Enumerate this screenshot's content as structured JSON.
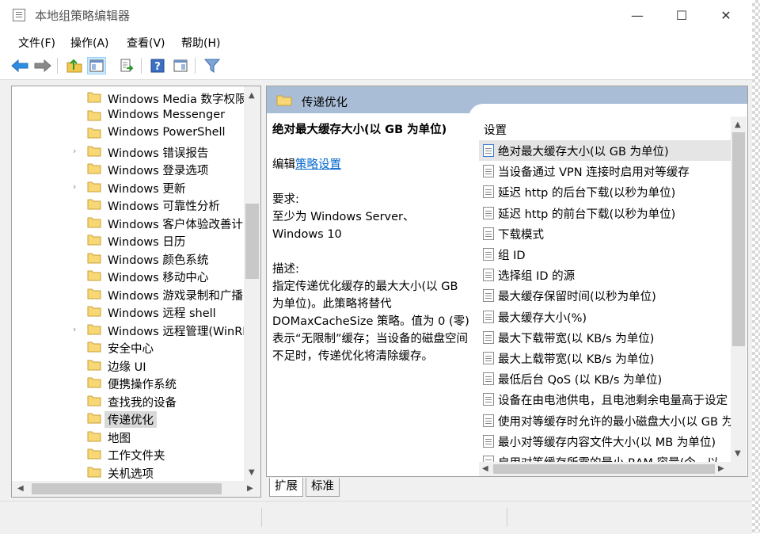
{
  "window": {
    "title": "本地组策略编辑器",
    "minimize": "—",
    "maximize": "☐",
    "close": "✕"
  },
  "menu": [
    "文件(F)",
    "操作(A)",
    "查看(V)",
    "帮助(H)"
  ],
  "toolbar": {
    "icons": [
      "back-arrow-icon",
      "forward-arrow-icon",
      "up-folder-icon",
      "show-hide-tree-icon",
      "export-list-icon",
      "help-icon",
      "properties-pane-icon",
      "filter-icon"
    ],
    "help_glyph": "?"
  },
  "tree": {
    "items": [
      {
        "label": "Windows Media 数字权限",
        "expandable": false
      },
      {
        "label": "Windows Messenger",
        "expandable": false
      },
      {
        "label": "Windows PowerShell",
        "expandable": false
      },
      {
        "label": "Windows 错误报告",
        "expandable": true
      },
      {
        "label": "Windows 登录选项",
        "expandable": false
      },
      {
        "label": "Windows 更新",
        "expandable": true
      },
      {
        "label": "Windows 可靠性分析",
        "expandable": false
      },
      {
        "label": "Windows 客户体验改善计",
        "expandable": false
      },
      {
        "label": "Windows 日历",
        "expandable": false
      },
      {
        "label": "Windows 颜色系统",
        "expandable": false
      },
      {
        "label": "Windows 移动中心",
        "expandable": false
      },
      {
        "label": "Windows 游戏录制和广播",
        "expandable": false
      },
      {
        "label": "Windows 远程 shell",
        "expandable": false
      },
      {
        "label": "Windows 远程管理(WinRI",
        "expandable": true
      },
      {
        "label": "安全中心",
        "expandable": false
      },
      {
        "label": "边缘 UI",
        "expandable": false
      },
      {
        "label": "便携操作系统",
        "expandable": false
      },
      {
        "label": "查找我的设备",
        "expandable": false
      },
      {
        "label": "传递优化",
        "expandable": false,
        "selected": true
      },
      {
        "label": "地图",
        "expandable": false
      },
      {
        "label": "工作文件夹",
        "expandable": false
      },
      {
        "label": "关机选项",
        "expandable": false
      }
    ],
    "expand_glyph": "›"
  },
  "right_pane": {
    "header_title": "传递优化",
    "policy_title": "绝对最大缓存大小(以 GB 为单位)",
    "edit_prefix": "编辑",
    "edit_link": "策略设置",
    "requirements_label": "要求:",
    "requirements_text_1": "至少为 Windows Server、",
    "requirements_text_2": "Windows 10",
    "description_label": "描述:",
    "description_lines": [
      "指定传递优化缓存的最大大小(以 GB",
      "为单位)。此策略将替代",
      "DOMaxCacheSize 策略。值为 0 (零)",
      "表示“无限制”缓存；当设备的磁盘空间",
      "不足时，传递优化将清除缓存。"
    ],
    "settings_header": "设置",
    "settings": [
      "绝对最大缓存大小(以 GB 为单位)",
      "当设备通过 VPN 连接时启用对等缓存",
      "延迟 http 的后台下载(以秒为单位)",
      "延迟 http 的前台下载(以秒为单位)",
      "下载模式",
      "组 ID",
      "选择组 ID 的源",
      "最大缓存保留时间(以秒为单位)",
      "最大缓存大小(%)",
      "最大下载带宽(以 KB/s 为单位)",
      "最大上载带宽(以 KB/s 为单位)",
      "最低后台 QoS (以 KB/s 为单位)",
      "设备在由电池供电，且电池剩余电量高于设定",
      "使用对等缓存时允许的最小磁盘大小(以 GB 为",
      "最小对等缓存内容文件大小(以 MB 为单位)",
      "启用对等缓存所需的最小 RAM 容量(今，以"
    ]
  },
  "tabs": [
    "扩展",
    "标准"
  ],
  "colors": {
    "header_bg": "#a9bdd6",
    "link": "#0066cc",
    "folder": "#f8d775",
    "selection": "#d9d9d9"
  }
}
